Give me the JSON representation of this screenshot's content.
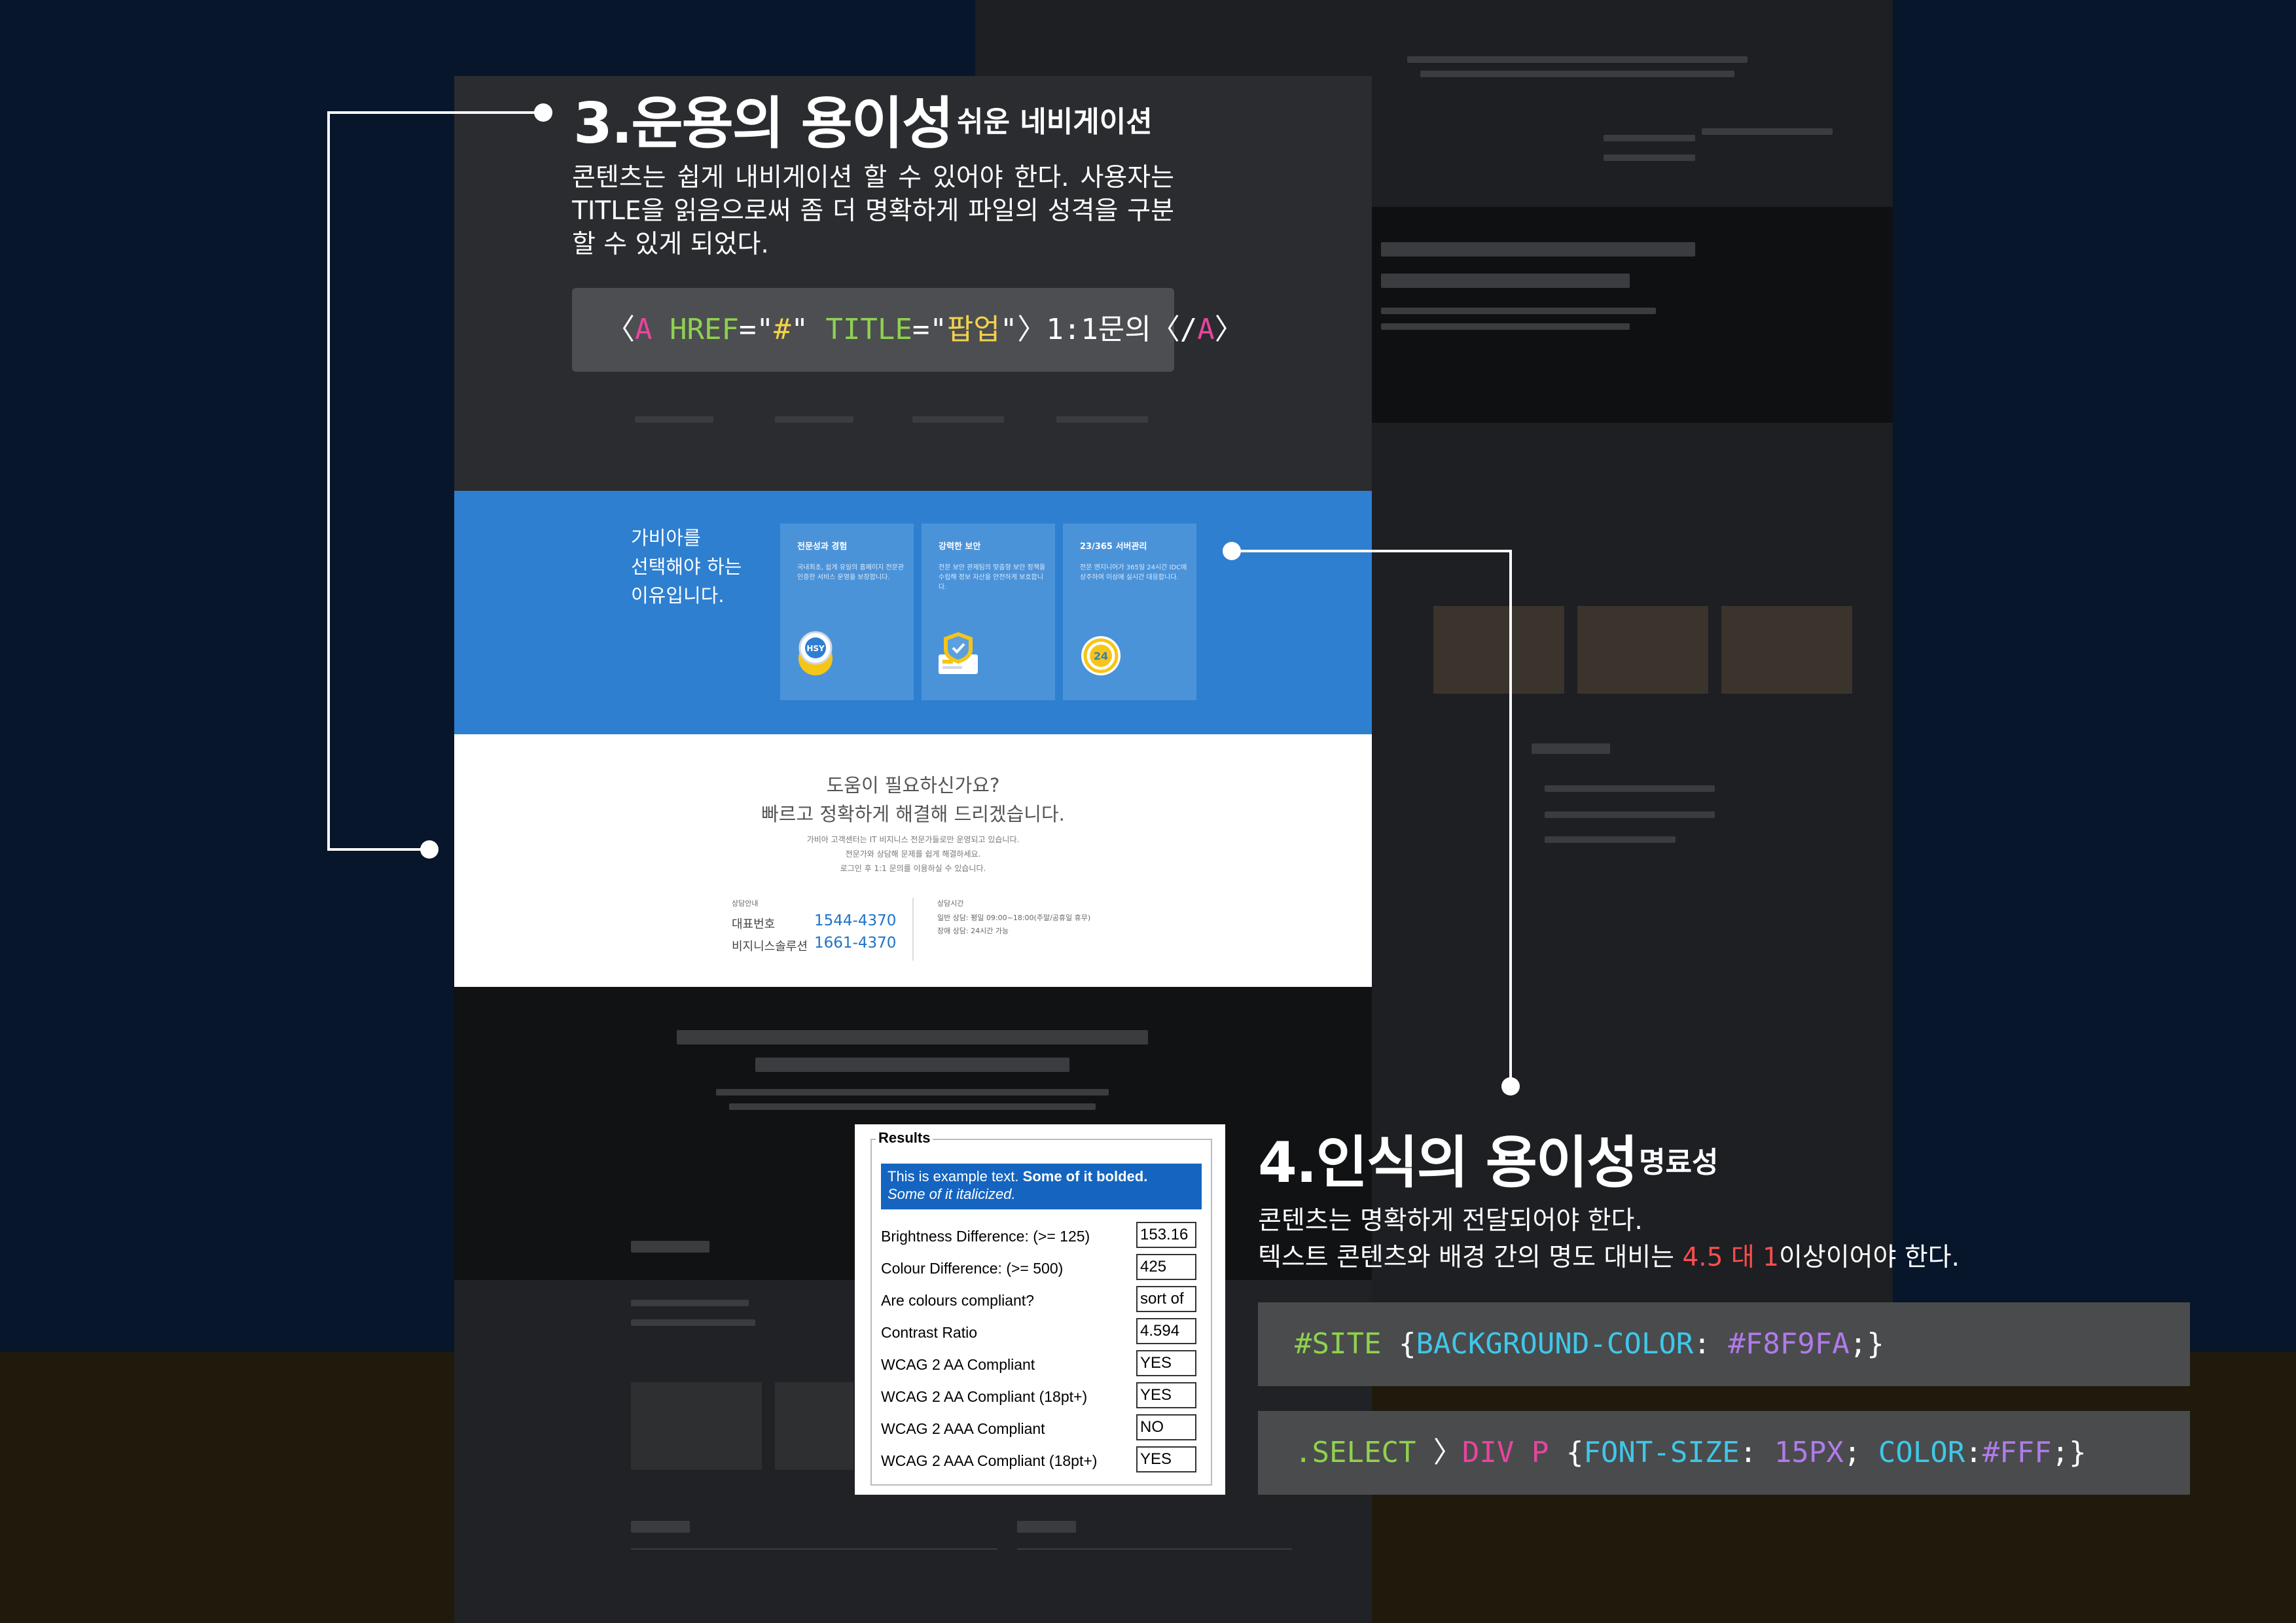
{
  "annotation3": {
    "heading": "3.운용의 용이성",
    "subheading": "쉬운 네비게이션",
    "body": "콘텐츠는 쉽게 내비게이션 할 수 있어야 한다. 사용자는 TITLE을 읽음으로써 좀 더 명확하게 파일의 성격을 구분할 수 있게 되었다.",
    "code": [
      {
        "t": "〈",
        "c": "#ffffff"
      },
      {
        "t": "A",
        "c": "#e8459e"
      },
      {
        "t": " HREF",
        "c": "#8fd14f"
      },
      {
        "t": "=\"",
        "c": "#ffffff"
      },
      {
        "t": "#",
        "c": "#f2d24b"
      },
      {
        "t": "\" ",
        "c": "#ffffff"
      },
      {
        "t": "TITLE",
        "c": "#8fd14f"
      },
      {
        "t": "=\"",
        "c": "#ffffff"
      },
      {
        "t": "팝업",
        "c": "#f2d24b"
      },
      {
        "t": "\"〉1:1문의〈/",
        "c": "#ffffff"
      },
      {
        "t": "A",
        "c": "#e8459e"
      },
      {
        "t": "〉",
        "c": "#ffffff"
      }
    ]
  },
  "annotation4": {
    "heading": "4.인식의 용이성",
    "subheading": "명료성",
    "body_line1": "콘텐츠는 명확하게 전달되어야 한다.",
    "body_line2_prefix": "텍스트 콘텐츠와 배경 간의 명도 대비는 ",
    "body_line2_highlight": "4.5 대 1",
    "body_line2_suffix": "이상이어야 한다.",
    "highlight_color": "#ff4d4d",
    "code1": [
      {
        "t": "#SITE ",
        "c": "#8fd14f"
      },
      {
        "t": "{",
        "c": "#ffffff"
      },
      {
        "t": "BACKGROUND-COLOR",
        "c": "#3fc7e8"
      },
      {
        "t": ": ",
        "c": "#ffffff"
      },
      {
        "t": "#F8F9FA",
        "c": "#b07be8"
      },
      {
        "t": ";}",
        "c": "#ffffff"
      }
    ],
    "code2": [
      {
        "t": ".SELECT ",
        "c": "#8fd14f"
      },
      {
        "t": "〉",
        "c": "#ffffff"
      },
      {
        "t": "DIV P ",
        "c": "#e8459e"
      },
      {
        "t": "{",
        "c": "#ffffff"
      },
      {
        "t": "FONT-SIZE",
        "c": "#3fc7e8"
      },
      {
        "t": ": ",
        "c": "#ffffff"
      },
      {
        "t": "15PX",
        "c": "#b07be8"
      },
      {
        "t": "; ",
        "c": "#ffffff"
      },
      {
        "t": "COLOR",
        "c": "#3fc7e8"
      },
      {
        "t": ":",
        "c": "#ffffff"
      },
      {
        "t": "#FFF",
        "c": "#b07be8"
      },
      {
        "t": ";}",
        "c": "#ffffff"
      }
    ]
  },
  "site": {
    "why": {
      "intro": [
        "가비아를",
        "선택해야 하는",
        "이유입니다."
      ],
      "cards": [
        {
          "title": "전문성과 경험",
          "desc": "국내최초, 쉽게 유일의 홈페이지 전문관 인증한 서비스 운영을 보장합니다.",
          "icon": "hsy-badge-icon"
        },
        {
          "title": "강력한 보안",
          "desc": "전문 보안 관제팀의 맞춤형 보안 정책을 수립해 정보 자산을 안전하게 보호합니다.",
          "icon": "shield-icon"
        },
        {
          "title": "23/365 서버관리",
          "desc": "전문 엔지니어가 365일 24시간 IDC에 상주하여 이상에 실시간 대응합니다.",
          "icon": "24-hour-icon"
        }
      ]
    },
    "help": {
      "title_line1": "도움이 필요하신가요?",
      "title_line2": "빠르고 정확하게 해결해 드리겠습니다.",
      "desc": [
        "가비아 고객센터는 IT 비지니스 전문가들로만 운영되고 있습니다.",
        "전문가와 상담해 문제를 쉽게 해결하세요.",
        "로그인 후 1:1 문의를 이용하실 수 있습니다."
      ],
      "consult_label": "상담안내",
      "rep_label": "대표번호",
      "rep_number": "1544-4370",
      "biz_label": "비지니스솔루션",
      "biz_number": "1661-4370",
      "hours_label": "상담시간",
      "hours_line1": "일반 상담: 평일 09:00~18:00(주말/공휴일 휴무)",
      "hours_line2": "장애 상담: 24시간 가능"
    }
  },
  "results": {
    "legend": "Results",
    "sample_bold_prefix": "This is example text. ",
    "sample_bold": "Some of it bolded.",
    "sample_italic": "Some of it italicized.",
    "rows": [
      {
        "label": "Brightness Difference: (>= 125)",
        "value": "153.16"
      },
      {
        "label": "Colour Difference: (>= 500)",
        "value": "425"
      },
      {
        "label": "Are colours compliant?",
        "value": "sort of"
      },
      {
        "label": "Contrast Ratio",
        "value": "4.594"
      },
      {
        "label": "WCAG 2 AA Compliant",
        "value": "YES"
      },
      {
        "label": "WCAG 2 AA Compliant (18pt+)",
        "value": "YES"
      },
      {
        "label": "WCAG 2 AAA Compliant",
        "value": "NO"
      },
      {
        "label": "WCAG 2 AAA Compliant (18pt+)",
        "value": "YES"
      }
    ]
  },
  "colors": {
    "background": "#07162a",
    "blue_section": "#2e7fd0",
    "accent_number": "#1e73c8"
  }
}
